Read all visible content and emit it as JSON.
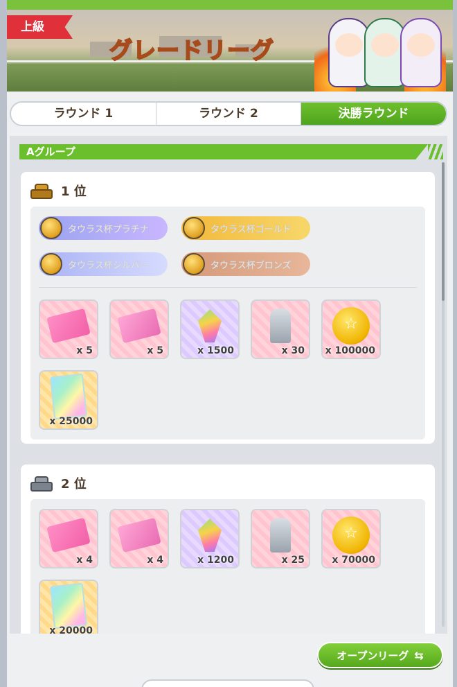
{
  "header": {
    "top_label": "",
    "rank_label": "上級",
    "league_title": "グレードリーグ"
  },
  "tabs": [
    {
      "label": "ラウンド 1",
      "active": false
    },
    {
      "label": "ラウンド 2",
      "active": false
    },
    {
      "label": "決勝ラウンド",
      "active": true
    }
  ],
  "group": {
    "label": "Aグループ"
  },
  "places": [
    {
      "label": "1 位",
      "trophy_color": "gold",
      "titles": [
        "タウラス杯プラチナ",
        "タウラス杯ゴールド",
        "タウラス杯シルバー",
        "タウラス杯ブロンズ"
      ],
      "rewards": [
        {
          "icon": "pink-ticket-icon",
          "qty": "x 5"
        },
        {
          "icon": "pink-ticket-icon",
          "qty": "x 5"
        },
        {
          "icon": "carrot-crystal-icon",
          "qty": "x 1500"
        },
        {
          "icon": "horse-statue-icon",
          "qty": "x 30"
        },
        {
          "icon": "gold-coin-icon",
          "qty": "x 100000"
        },
        {
          "icon": "rainbow-card-icon",
          "qty": "x 25000"
        }
      ]
    },
    {
      "label": "2 位",
      "trophy_color": "silver",
      "titles": [],
      "rewards": [
        {
          "icon": "pink-ticket-icon",
          "qty": "x 4"
        },
        {
          "icon": "pink-ticket-icon",
          "qty": "x 4"
        },
        {
          "icon": "carrot-crystal-icon",
          "qty": "x 1200"
        },
        {
          "icon": "horse-statue-icon",
          "qty": "x 25"
        },
        {
          "icon": "gold-coin-icon",
          "qty": "x 70000"
        },
        {
          "icon": "rainbow-card-icon",
          "qty": "x 20000"
        }
      ]
    }
  ],
  "open_league_button": {
    "label": "オープンリーグ",
    "icon": "swap-arrows-icon"
  },
  "colors": {
    "accent_green": "#6bbf2c",
    "rank_red": "#e0303a",
    "text_brown": "#4b3b2b"
  }
}
